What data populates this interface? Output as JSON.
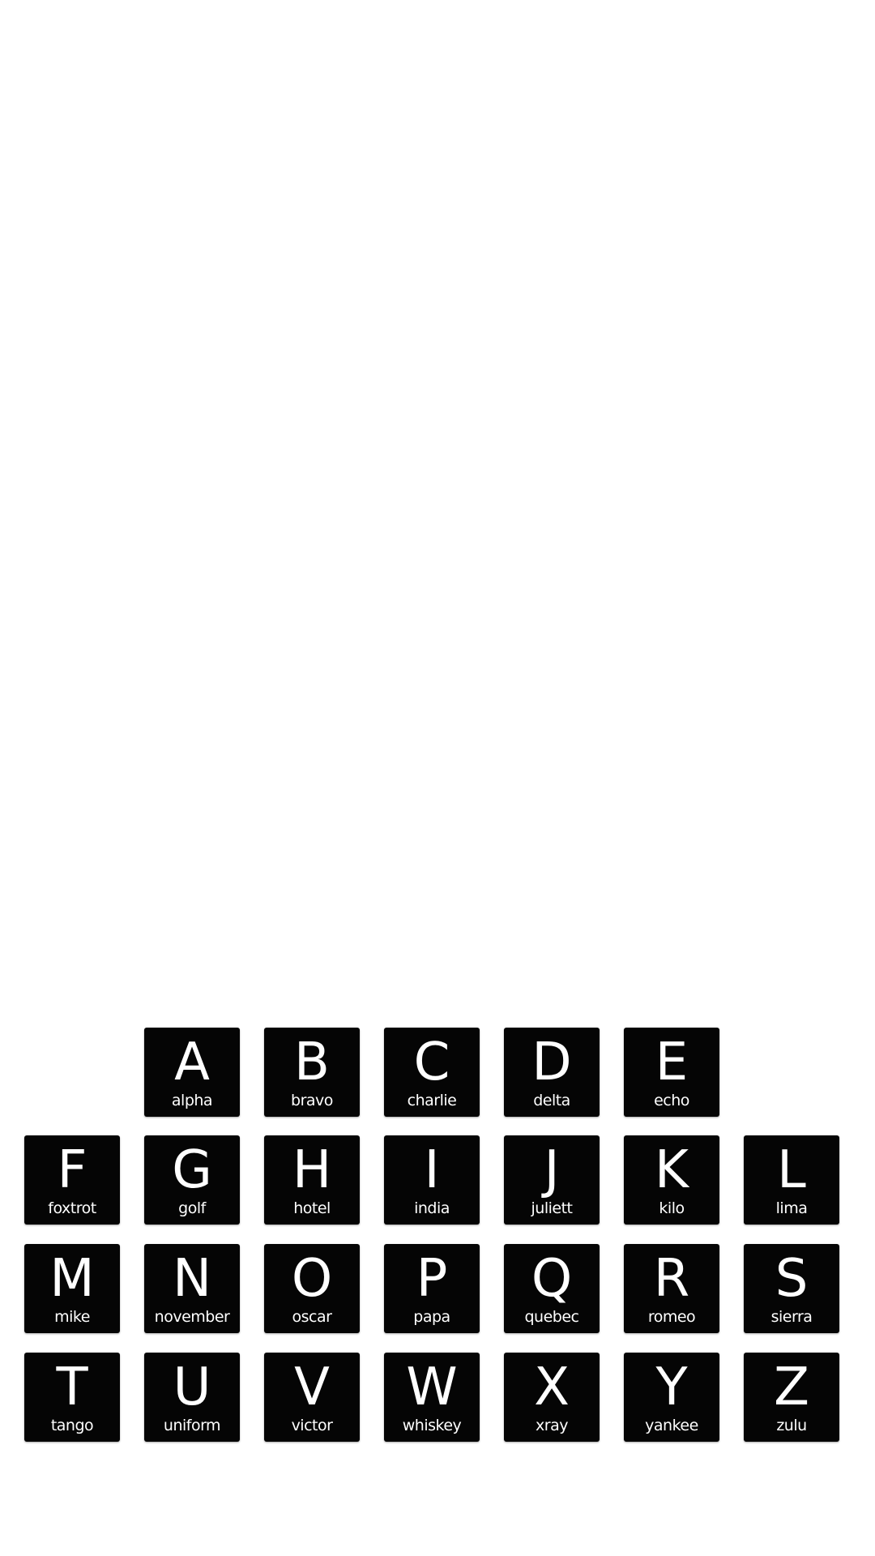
{
  "rows": [
    [
      {
        "letter": "A",
        "word": "alpha"
      },
      {
        "letter": "B",
        "word": "bravo"
      },
      {
        "letter": "C",
        "word": "charlie"
      },
      {
        "letter": "D",
        "word": "delta"
      },
      {
        "letter": "E",
        "word": "echo"
      }
    ],
    [
      {
        "letter": "F",
        "word": "foxtrot"
      },
      {
        "letter": "G",
        "word": "golf"
      },
      {
        "letter": "H",
        "word": "hotel"
      },
      {
        "letter": "I",
        "word": "india"
      },
      {
        "letter": "J",
        "word": "juliett"
      },
      {
        "letter": "K",
        "word": "kilo"
      },
      {
        "letter": "L",
        "word": "lima"
      }
    ],
    [
      {
        "letter": "M",
        "word": "mike"
      },
      {
        "letter": "N",
        "word": "november"
      },
      {
        "letter": "O",
        "word": "oscar"
      },
      {
        "letter": "P",
        "word": "papa"
      },
      {
        "letter": "Q",
        "word": "quebec"
      },
      {
        "letter": "R",
        "word": "romeo"
      },
      {
        "letter": "S",
        "word": "sierra"
      }
    ],
    [
      {
        "letter": "T",
        "word": "tango"
      },
      {
        "letter": "U",
        "word": "uniform"
      },
      {
        "letter": "V",
        "word": "victor"
      },
      {
        "letter": "W",
        "word": "whiskey"
      },
      {
        "letter": "X",
        "word": "xray"
      },
      {
        "letter": "Y",
        "word": "yankee"
      },
      {
        "letter": "Z",
        "word": "zulu"
      }
    ]
  ],
  "colors": {
    "background": "#ffffff",
    "tile": "#050505",
    "text": "#ffffff"
  }
}
